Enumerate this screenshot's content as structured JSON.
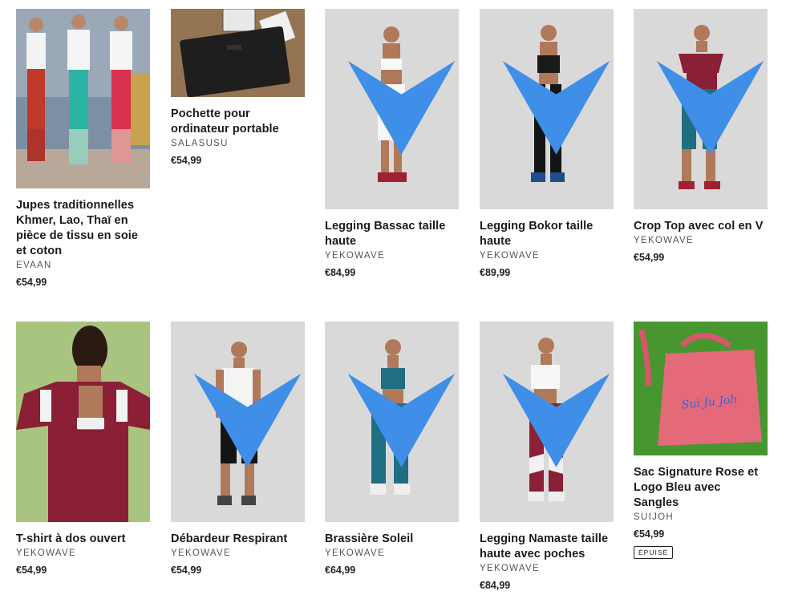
{
  "products": [
    {
      "title": "Jupes traditionnelles Khmer, Lao, Thaï en pièce de tissu en soie et coton",
      "vendor": "EVAAN",
      "price": "€54,99"
    },
    {
      "title": "Pochette pour ordinateur portable",
      "vendor": "SALASUSU",
      "price": "€54,99"
    },
    {
      "title": "Legging Bassac taille haute",
      "vendor": "YEKOWAVE",
      "price": "€84,99"
    },
    {
      "title": "Legging Bokor taille haute",
      "vendor": "YEKOWAVE",
      "price": "€89,99"
    },
    {
      "title": "Crop Top avec col en V",
      "vendor": "YEKOWAVE",
      "price": "€54,99"
    },
    {
      "title": "T-shirt à dos ouvert",
      "vendor": "YEKOWAVE",
      "price": "€54,99"
    },
    {
      "title": "Débardeur Respirant",
      "vendor": "YEKOWAVE",
      "price": "€54,99"
    },
    {
      "title": "Brassière Soleil",
      "vendor": "YEKOWAVE",
      "price": "€64,99"
    },
    {
      "title": "Legging Namaste taille haute avec poches",
      "vendor": "YEKOWAVE",
      "price": "€84,99"
    },
    {
      "title": "Sac Signature Rose et Logo Bleu avec Sangles",
      "vendor": "SUIJOH",
      "price": "€54,99",
      "badge": "ÉPUISÉ",
      "bag_text": "Sui Ju Joh"
    }
  ],
  "colors": {
    "studio_bg": "#d9d9d9",
    "green_bg": "#a9c47f",
    "grass": "#3f8d2c",
    "maroon": "#8a1f35",
    "teal": "#1f6e82",
    "bag_pink": "#e46a7a",
    "bag_text": "#3a63d6"
  }
}
